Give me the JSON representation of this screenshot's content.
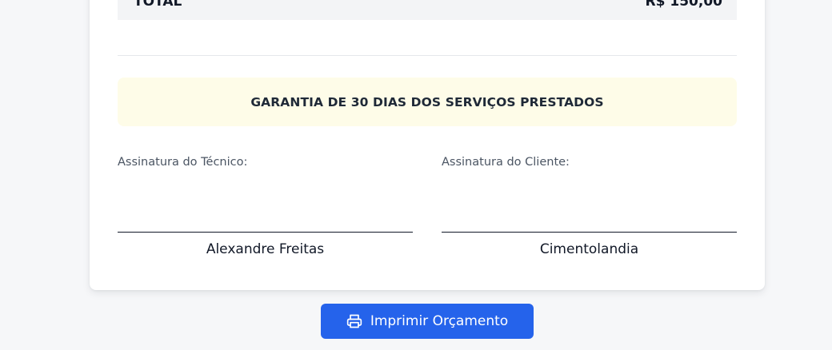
{
  "totals": {
    "label": "TOTAL",
    "value": "R$ 150,00"
  },
  "guarantee": {
    "text": "GARANTIA DE 30 DIAS DOS SERVIÇOS PRESTADOS"
  },
  "signatures": {
    "technician": {
      "label": "Assinatura do Técnico:",
      "name": "Alexandre Freitas"
    },
    "client": {
      "label": "Assinatura do Cliente:",
      "name": "Cimentolandia"
    }
  },
  "actions": {
    "print_label": "Imprimir Orçamento",
    "print_icon": "printer-icon"
  },
  "colors": {
    "primary": "#2563eb",
    "notice_bg": "#fefce8",
    "page_bg": "#f6f7f9"
  }
}
